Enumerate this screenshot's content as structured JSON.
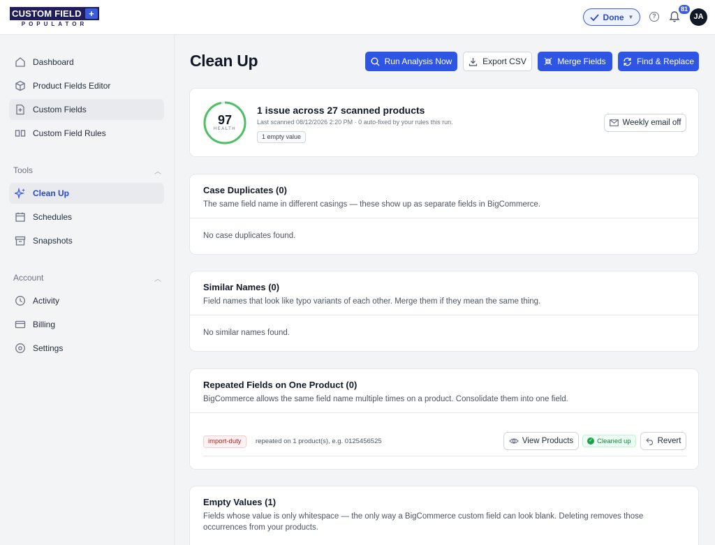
{
  "app": {
    "logo_main": "CUSTOM FIELD",
    "logo_plus": "+",
    "logo_sub": "POPULATOR"
  },
  "header": {
    "done_label": "Done",
    "notification_count": "81",
    "avatar_initials": "JA"
  },
  "sidebar": {
    "items": [
      {
        "label": "Dashboard",
        "icon": "home-icon"
      },
      {
        "label": "Product Fields Editor",
        "icon": "box-icon"
      },
      {
        "label": "Custom Fields",
        "icon": "file-plus-icon"
      },
      {
        "label": "Custom Field Rules",
        "icon": "rules-icon"
      }
    ],
    "tools_section": "Tools",
    "tools_items": [
      {
        "label": "Clean Up",
        "icon": "sparkles-icon"
      },
      {
        "label": "Schedules",
        "icon": "calendar-icon"
      },
      {
        "label": "Snapshots",
        "icon": "archive-icon"
      }
    ],
    "account_section": "Account",
    "account_items": [
      {
        "label": "Activity",
        "icon": "clock-icon"
      },
      {
        "label": "Billing",
        "icon": "credit-card-icon"
      },
      {
        "label": "Settings",
        "icon": "settings-icon"
      }
    ]
  },
  "page": {
    "title": "Clean Up",
    "actions": {
      "run_analysis": "Run Analysis Now",
      "export_csv": "Export CSV",
      "merge_fields": "Merge Fields",
      "find_replace": "Find & Replace"
    }
  },
  "summary": {
    "health_score": "97",
    "health_label": "HEALTH",
    "health_fraction": 0.97,
    "title": "1 issue across 27 scanned products",
    "subtitle": "Last scanned 08/12/2026 2:20 PM · 0 auto-fixed by your rules this run.",
    "chip": "1 empty value",
    "weekly_email": "Weekly email off"
  },
  "sections": {
    "case_duplicates": {
      "title": "Case Duplicates (0)",
      "description": "The same field name in different casings — these show up as separate fields in BigCommerce.",
      "empty": "No case duplicates found."
    },
    "similar_names": {
      "title": "Similar Names (0)",
      "description": "Field names that look like typo variants of each other. Merge them if they mean the same thing.",
      "empty": "No similar names found."
    },
    "repeated_fields": {
      "title": "Repeated Fields on One Product (0)",
      "description": "BigCommerce allows the same field name multiple times on a product. Consolidate them into one field.",
      "row": {
        "tag": "import-duty",
        "text": "repeated on 1 product(s), e.g. 0125456525",
        "view_products": "View Products",
        "status": "Cleaned up",
        "revert": "Revert"
      }
    },
    "empty_values": {
      "title": "Empty Values (1)",
      "description": "Fields whose value is only whitespace — the only way a BigCommerce custom field can look blank. Deleting removes those occurrences from your products."
    }
  },
  "colors": {
    "primary": "#2f55e4",
    "health_ring": "#4cc063",
    "brand_dark": "#1f1d5c"
  }
}
